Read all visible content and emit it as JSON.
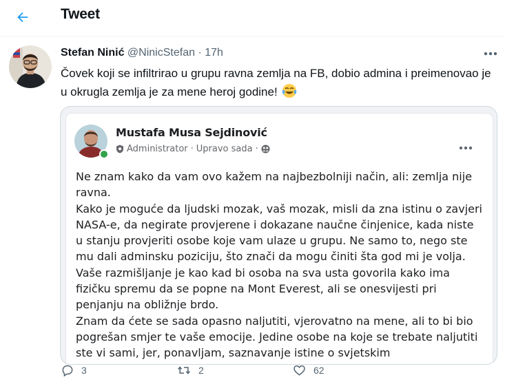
{
  "header": {
    "title": "Tweet"
  },
  "tweet": {
    "author_name": "Stefan Ninić",
    "handle": "@NinicStefan",
    "separator": "·",
    "time": "17h",
    "text": "Čovek koji se infiltrirao u grupu ravna zemlja na FB, dobio admina i preimenovao je u okrugla zemlja je za mene heroj godine!",
    "emoji": "face-with-tears-of-joy",
    "stats": {
      "replies": "3",
      "retweets": "2",
      "likes": "62"
    }
  },
  "embedded_post": {
    "author_name": "Mustafa Musa Sejdinović",
    "role": "Administrator",
    "separator": "·",
    "time": "Upravo sada",
    "meta_separator": "·",
    "paragraphs": [
      "Ne znam kako da vam ovo kažem na najbezbolniji način, ali: zemlja nije ravna.",
      "Kako je moguće da ljudski mozak, vaš mozak, misli da zna istinu o zavjeri NASA-e, da negirate provjerene i dokazane naučne činjenice, kada niste u stanju provjeriti osobe koje vam ulaze u grupu. Ne samo to, nego ste mu dali adminsku poziciju, što znači da mogu činiti šta god mi je volja. Vaše razmišljanje je kao kad bi osoba na sva usta govorila kako ima fizičku spremu da se popne na Mont Everest, ali se onesvijesti pri penjanju na obližnje brdo.",
      "Znam da ćete se sada opasno naljutiti, vjerovatno na mene, ali to bi bio pogrešan smjer te vaše emocije. Jedine osobe na koje se trebate naljutiti ste vi sami, jer, ponavljam, saznavanje istine o svjetskim"
    ]
  },
  "colors": {
    "accent": "#1d9bf0",
    "text_secondary": "#536471",
    "fb_online": "#31a24c",
    "border": "#cfd9de"
  }
}
